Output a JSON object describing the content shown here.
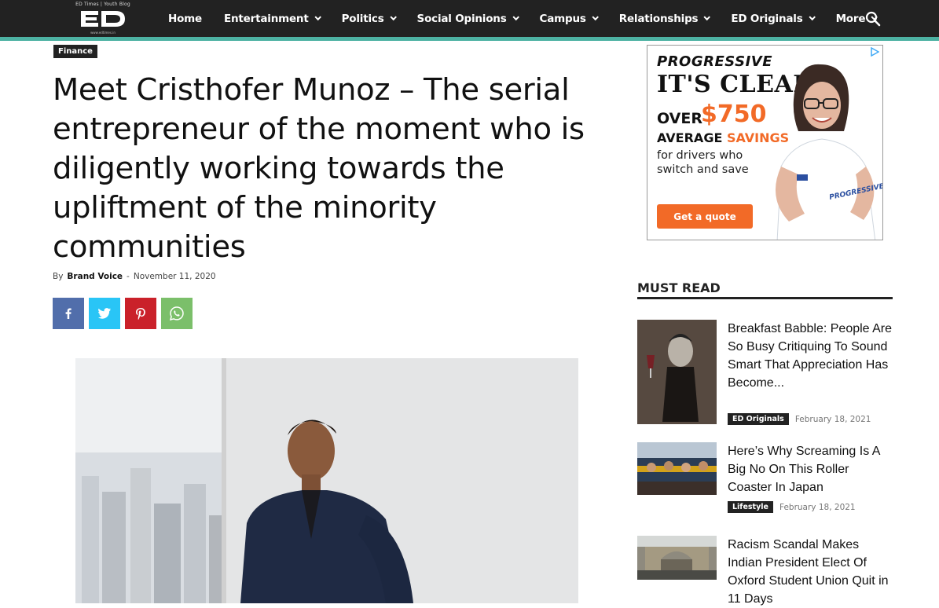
{
  "header": {
    "logo_tagline": "ED Times | Youth Blog",
    "logo_text": "eD",
    "logo_url": "www.edtimes.in",
    "nav": [
      {
        "label": "Home",
        "has_dropdown": false
      },
      {
        "label": "Entertainment",
        "has_dropdown": true
      },
      {
        "label": "Politics",
        "has_dropdown": true
      },
      {
        "label": "Social Opinions",
        "has_dropdown": true
      },
      {
        "label": "Campus",
        "has_dropdown": true
      },
      {
        "label": "Relationships",
        "has_dropdown": true
      },
      {
        "label": "ED Originals",
        "has_dropdown": true
      },
      {
        "label": "More",
        "has_dropdown": true
      }
    ],
    "search_icon": "search-icon",
    "accent_color": "#4db2a3"
  },
  "article": {
    "category": "Finance",
    "title": "Meet Cristhofer Munoz – The serial entrepreneur of the moment who is diligently working towards the upliftment of the minority communities",
    "by_label": "By",
    "author": "Brand Voice",
    "separator": "-",
    "date": "November 11, 2020",
    "share_buttons": [
      {
        "network": "facebook",
        "icon": "facebook-icon",
        "color": "#516eab"
      },
      {
        "network": "twitter",
        "icon": "twitter-icon",
        "color": "#29c5f6"
      },
      {
        "network": "pinterest",
        "icon": "pinterest-icon",
        "color": "#ca212a"
      },
      {
        "network": "whatsapp",
        "icon": "whatsapp-icon",
        "color": "#7bbf6a"
      }
    ]
  },
  "ad": {
    "brand": "PROGRESSIVE",
    "headline": "IT'S CLEAR",
    "over": "OVER",
    "amount": "$750",
    "average": "AVERAGE",
    "savings": "SAVINGS",
    "subtext": "for drivers who switch and save",
    "cta": "Get a quote",
    "shirt_text": "PROGRESSIVE",
    "accent_color": "#f26a27"
  },
  "must_read": {
    "heading": "MUST READ",
    "items": [
      {
        "title": "Breakfast Babble: People Are So Busy Critiquing To Sound Smart That Appreciation Has Become...",
        "category": "ED Originals",
        "date": "February 18, 2021"
      },
      {
        "title": "Here’s Why Screaming Is A Big No On This Roller Coaster In Japan",
        "category": "Lifestyle",
        "date": "February 18, 2021"
      },
      {
        "title": "Racism Scandal Makes Indian President Elect Of Oxford Student Union Quit in 11 Days",
        "category": "",
        "date": ""
      }
    ]
  }
}
